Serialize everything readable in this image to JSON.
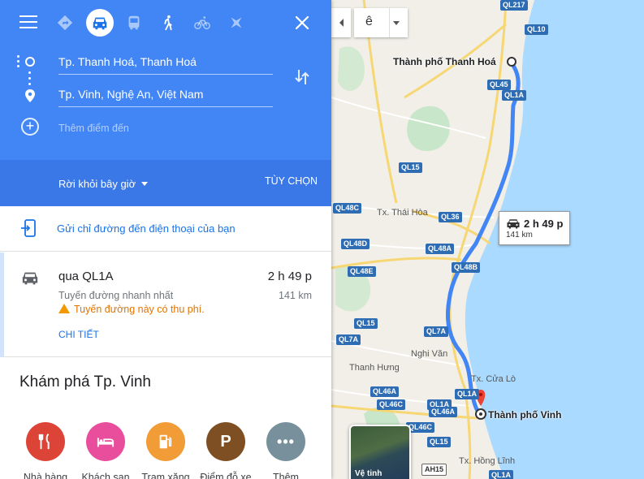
{
  "travel_modes": [
    {
      "name": "best-route",
      "active": false
    },
    {
      "name": "driving",
      "active": true
    },
    {
      "name": "transit",
      "active": false
    },
    {
      "name": "walking",
      "active": false
    },
    {
      "name": "cycling",
      "active": false
    },
    {
      "name": "flight",
      "active": false
    }
  ],
  "directions": {
    "origin": "Tp. Thanh Hoá, Thanh Hoá",
    "destination": "Tp. Vinh, Nghệ An, Việt Nam",
    "add_destination_placeholder": "Thêm điểm đến"
  },
  "depart": {
    "label": "Rời khỏi bây giờ",
    "options_label": "TÙY CHỌN"
  },
  "send_to_phone": "Gửi chỉ đường đến điện thoại của bạn",
  "route": {
    "via": "qua QL1A",
    "duration": "2 h 49 p",
    "subtitle": "Tuyến đường nhanh nhất",
    "distance": "141 km",
    "warning": "Tuyến đường này có thu phí.",
    "details_label": "CHI TIẾT"
  },
  "explore": {
    "title": "Khám phá Tp. Vinh",
    "categories": [
      {
        "label": "Nhà hàng",
        "icon": "restaurant-icon",
        "color": "#db4437"
      },
      {
        "label": "Khách sạn",
        "icon": "hotel-icon",
        "color": "#e94e9c"
      },
      {
        "label": "Trạm xăng",
        "icon": "gas-station-icon",
        "color": "#f29c38"
      },
      {
        "label": "Điểm đỗ xe",
        "icon": "parking-icon",
        "color": "#7f4f24"
      },
      {
        "label": "Thêm",
        "icon": "more-icon",
        "color": "#78909c"
      }
    ]
  },
  "map": {
    "language_value": "ê",
    "origin_city": "Thành phố Thanh Hoá",
    "destination_city": "Thành phố Vinh",
    "callout_duration": "2 h 49 p",
    "callout_distance": "141 km",
    "satellite_label": "Vệ tinh",
    "places": [
      "Tx. Thái Hòa",
      "Nghi Văn",
      "Thanh Hưng",
      "Tx. Cửa Lò",
      "Tx. Hồng Lĩnh"
    ],
    "road_labels": [
      "QL217",
      "QL10",
      "QL45",
      "QL1A",
      "QL15",
      "QL48C",
      "QL36",
      "QL48D",
      "QL48A",
      "QL48E",
      "QL48B",
      "QL15",
      "QL7A",
      "QL7A",
      "QL1A",
      "QL46A",
      "QL46C",
      "QL1A",
      "QL46A",
      "QL46C",
      "QL15",
      "AH15",
      "QL1A"
    ]
  },
  "colors": {
    "header": "#4285f4",
    "depart_bar": "#3b78e7",
    "route_line": "#4285f4",
    "sea": "#aadaff",
    "link": "#1a73e8"
  }
}
